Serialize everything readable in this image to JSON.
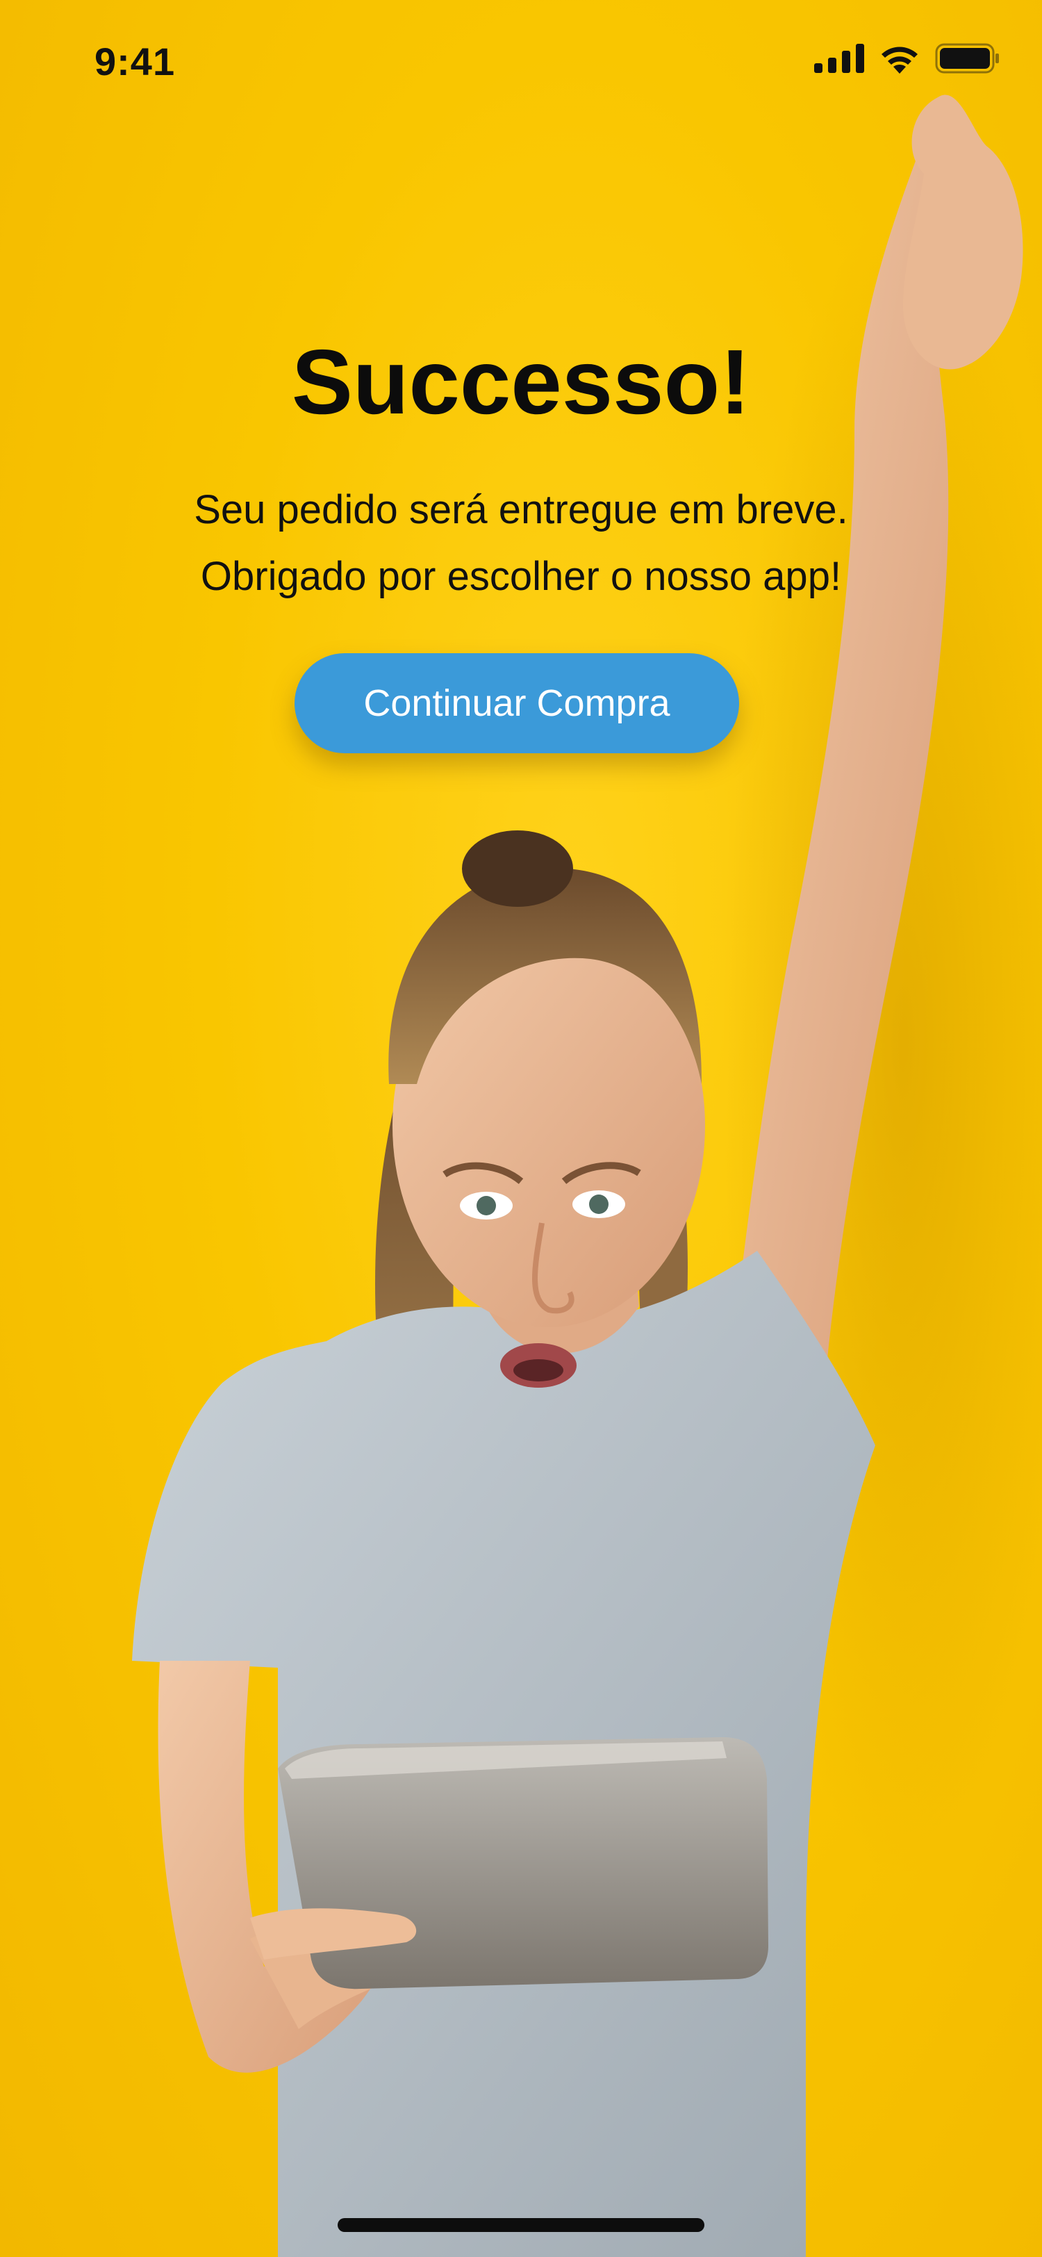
{
  "status_bar": {
    "time": "9:41",
    "icons": [
      "cellular-signal-icon",
      "wifi-icon",
      "battery-icon"
    ]
  },
  "success": {
    "title": "Successo!",
    "message_line_1": "Seu pedido será entregue em breve.",
    "message_line_2": "Obrigado por escolher o nosso app!",
    "button_label": "Continuar Compra"
  },
  "illustration": {
    "description_icon": "celebrating-person-with-tablet-photo"
  },
  "colors": {
    "background": "#f9c600",
    "button": "#3b9ad9",
    "button_text": "#ffffff",
    "title_text": "#0c0c0c"
  }
}
